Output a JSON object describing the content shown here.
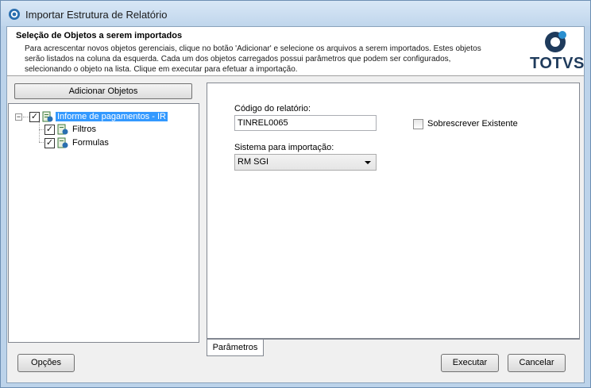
{
  "window": {
    "title": "Importar Estrutura de Relatório"
  },
  "header": {
    "title": "Seleção de Objetos a serem importados",
    "description": "Para acrescentar novos objetos gerenciais, clique no botão 'Adicionar' e selecione os arquivos a serem importados. Estes objetos serão listados na coluna da esquerda. Cada um dos objetos carregados possui parâmetros que podem ser configurados, selecionando o objeto na lista. Clique em executar para efetuar a importação.",
    "logo_text": "TOTVS"
  },
  "left": {
    "add_button_label": "Adicionar Objetos",
    "tree": [
      {
        "label": "Informe de pagamentos - IR",
        "checked": true,
        "selected": true,
        "icon": "report-object-icon"
      },
      {
        "label": "Filtros",
        "checked": true,
        "selected": false,
        "icon": "filter-object-icon"
      },
      {
        "label": "Formulas",
        "checked": true,
        "selected": false,
        "icon": "formula-object-icon"
      }
    ]
  },
  "params": {
    "report_code_label": "Código do relatório:",
    "report_code_value": "TINREL0065",
    "overwrite_label": "Sobrescrever Existente",
    "overwrite_checked": false,
    "system_label": "Sistema para importação:",
    "system_value": "RM SGI",
    "tab_label": "Parâmetros"
  },
  "footer": {
    "options_label": "Opções",
    "execute_label": "Executar",
    "cancel_label": "Cancelar"
  },
  "colors": {
    "window_frame": "#bcd3ea",
    "selection": "#3399ff",
    "logo_blue": "#1f3b5c",
    "logo_accent": "#2a8fd0"
  }
}
